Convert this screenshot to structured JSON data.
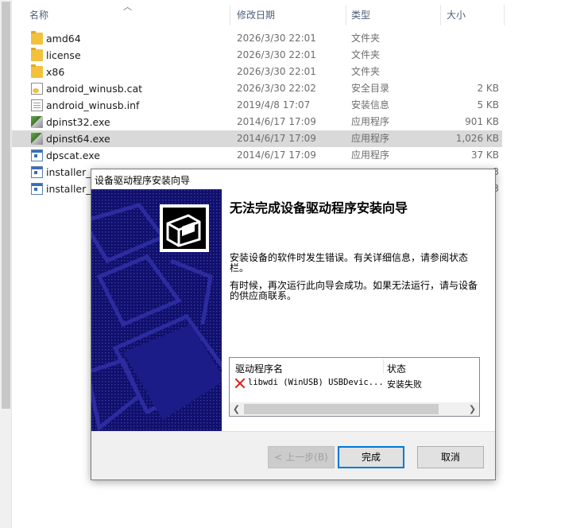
{
  "explorer": {
    "columns": {
      "name": "名称",
      "date": "修改日期",
      "type": "类型",
      "size": "大小"
    },
    "files": [
      {
        "name": "amd64",
        "date": "2026/3/30 22:01",
        "type": "文件夹",
        "size": "",
        "icon": "folder-icon"
      },
      {
        "name": "license",
        "date": "2026/3/30 22:01",
        "type": "文件夹",
        "size": "",
        "icon": "folder-icon"
      },
      {
        "name": "x86",
        "date": "2026/3/30 22:01",
        "type": "文件夹",
        "size": "",
        "icon": "folder-icon"
      },
      {
        "name": "android_winusb.cat",
        "date": "2026/3/30 22:02",
        "type": "安全目录",
        "size": "2 KB",
        "icon": "catalog-icon"
      },
      {
        "name": "android_winusb.inf",
        "date": "2019/4/8 17:07",
        "type": "安装信息",
        "size": "5 KB",
        "icon": "inf-file-icon"
      },
      {
        "name": "dpinst32.exe",
        "date": "2014/6/17 17:09",
        "type": "应用程序",
        "size": "901 KB",
        "icon": "setup-exe-icon"
      },
      {
        "name": "dpinst64.exe",
        "date": "2014/6/17 17:09",
        "type": "应用程序",
        "size": "1,026 KB",
        "icon": "setup-exe-icon",
        "selected": true
      },
      {
        "name": "dpscat.exe",
        "date": "2014/6/17 17:09",
        "type": "应用程序",
        "size": "37 KB",
        "icon": "exe-icon"
      },
      {
        "name": "installer_x",
        "date": "",
        "type": "",
        "size": "3",
        "icon": "exe-icon"
      },
      {
        "name": "installer_x",
        "date": "",
        "type": "",
        "size": "3",
        "icon": "exe-icon"
      }
    ]
  },
  "dialog": {
    "title": "设备驱动程序安装向导",
    "heading": "无法完成设备驱动程序安装向导",
    "text1": "安装设备的软件时发生错误。有关详细信息，请参阅状态栏。",
    "text2": "有时候，再次运行此向导会成功。如果无法运行，请与设备的供应商联系。",
    "list": {
      "col_driver": "驱动程序名",
      "col_status": "状态",
      "rows": [
        {
          "driver": "libwdi (WinUSB) USBDevic...",
          "status": "安装失败",
          "icon": "error-x-icon"
        }
      ]
    },
    "buttons": {
      "back": "< 上一步(B)",
      "finish": "完成",
      "cancel": "取消"
    }
  },
  "colors": {
    "banner": "#10106c",
    "selection": "#d9d9d9",
    "accent": "#0078d7",
    "error": "#e01818"
  }
}
